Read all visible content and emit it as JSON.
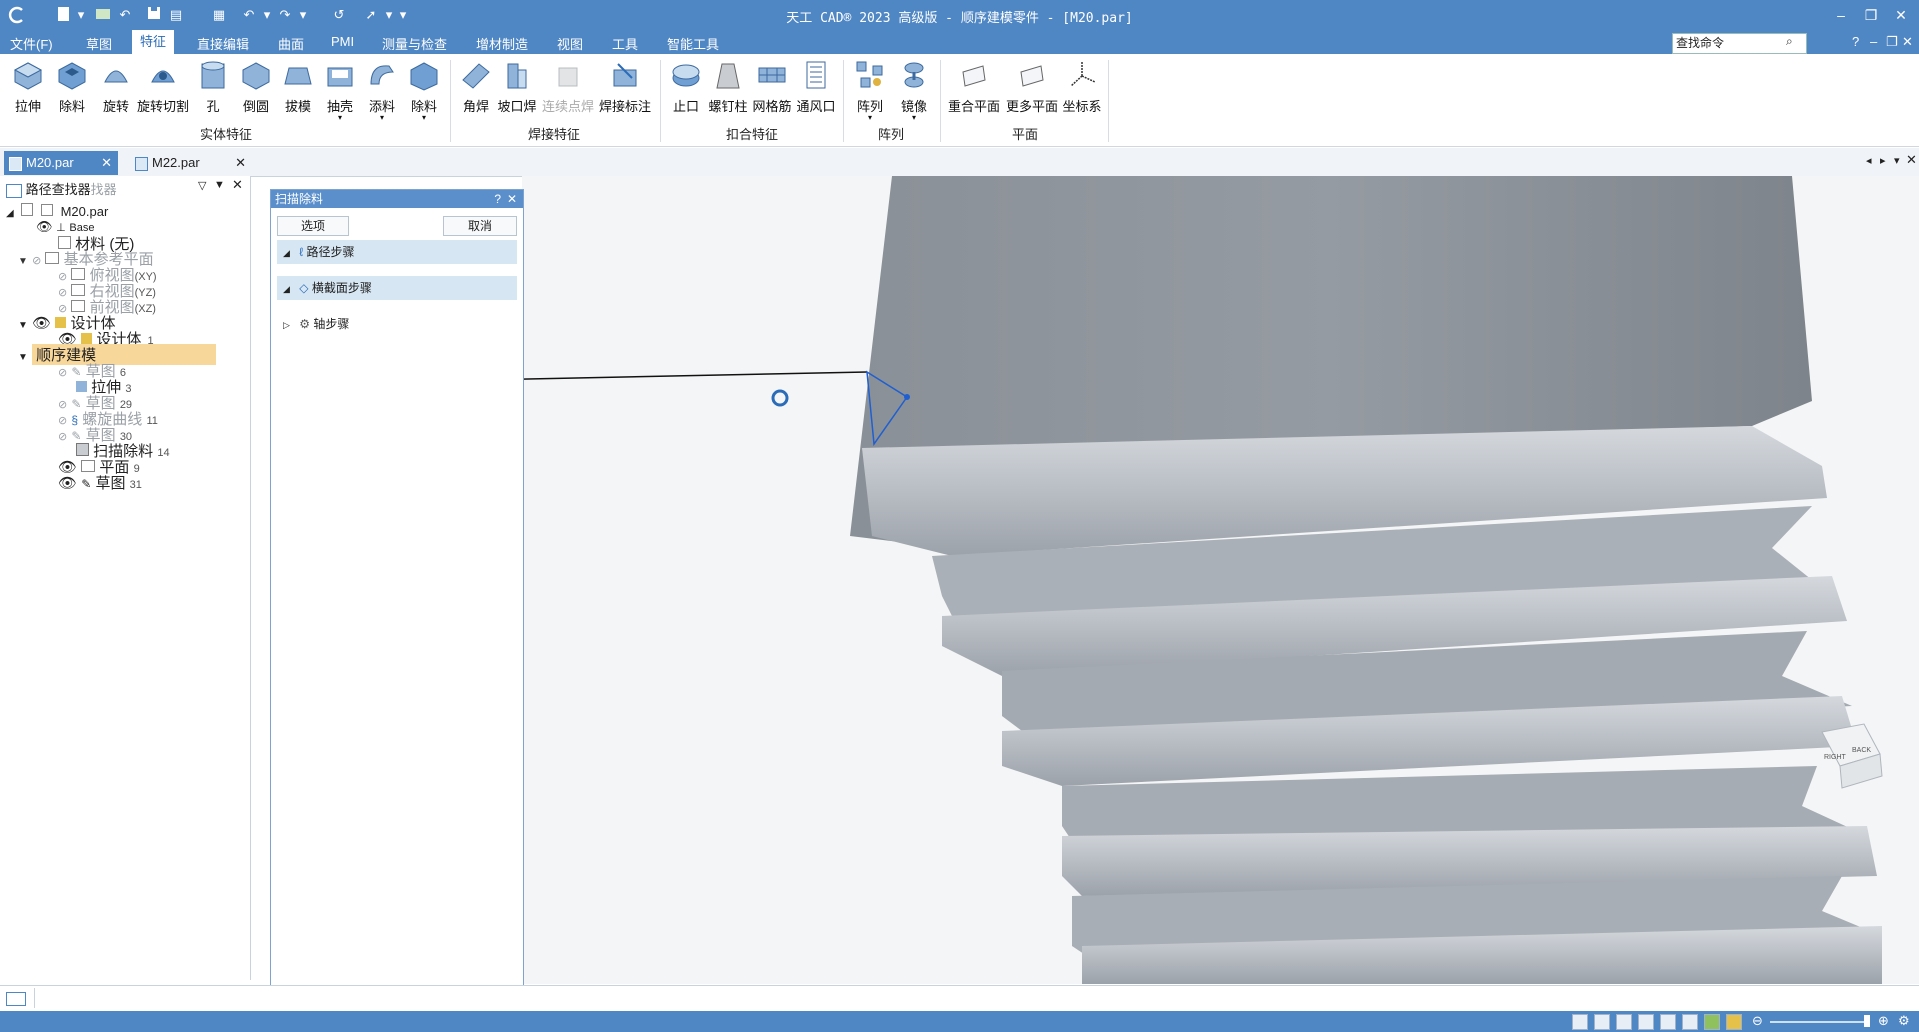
{
  "app": {
    "title": "天工 CAD® 2023 高级版 - 顺序建模零件 - [M20.par]",
    "accent": "#4f86c4"
  },
  "menu": {
    "items": [
      "文件(F)",
      "草图",
      "特征",
      "直接编辑",
      "曲面",
      "PMI",
      "测量与检查",
      "增材制造",
      "视图",
      "工具",
      "智能工具"
    ],
    "active": "特征",
    "search_placeholder": "查找命令",
    "help": "?"
  },
  "ribbon": {
    "solid": {
      "group_label": "实体特征",
      "tools": [
        "拉伸",
        "除料",
        "旋转",
        "旋转切割",
        "孔",
        "倒圆",
        "拔模",
        "抽壳",
        "添料",
        "除料"
      ]
    },
    "weld": {
      "group_label": "焊接特征",
      "tools": [
        "角焊",
        "坡口焊",
        "连续点焊",
        "焊接标注"
      ]
    },
    "buckle": {
      "group_label": "扣合特征",
      "tools": [
        "止口",
        "螺钉柱",
        "网格筋",
        "通风口"
      ]
    },
    "pattern": {
      "group_label": "阵列",
      "tools": [
        "阵列",
        "镜像"
      ]
    },
    "plane": {
      "group_label": "平面",
      "tools": [
        "重合平面",
        "更多平面",
        "坐标系"
      ]
    }
  },
  "tabs": [
    {
      "label": "M20.par",
      "active": true
    },
    {
      "label": "M22.par",
      "active": false
    }
  ],
  "pathfinder": {
    "title": "路径查找器",
    "title_faded": "找器",
    "root": "M20.par",
    "base": "Base",
    "material": "材料 (无)",
    "ref_planes": "基本参考平面",
    "planes": [
      {
        "name": "俯视图",
        "axis": "(XY)"
      },
      {
        "name": "右视图",
        "axis": "(YZ)"
      },
      {
        "name": "前视图",
        "axis": "(XZ)"
      }
    ],
    "design_body": "设计体",
    "design_body_item": {
      "name": "设计体",
      "num": "_1"
    },
    "ordered": "顺序建模",
    "features": [
      {
        "name": "草图",
        "num": "6",
        "dim": true
      },
      {
        "name": "拉伸",
        "num": "3",
        "dim": false
      },
      {
        "name": "草图",
        "num": "29",
        "dim": true
      },
      {
        "name": "螺旋曲线",
        "num": "11",
        "dim": true
      },
      {
        "name": "草图",
        "num": "30",
        "dim": true
      },
      {
        "name": "扫描除料",
        "num": "14",
        "dim": false
      },
      {
        "name": "平面",
        "num": "9",
        "dim": false
      },
      {
        "name": "草图",
        "num": "31",
        "dim": false
      }
    ]
  },
  "sweep_panel": {
    "title": "扫描除料",
    "help": "?",
    "options_label": "选项",
    "cancel_label": "取消",
    "steps": [
      "路径步骤",
      "横截面步骤",
      "轴步骤"
    ]
  },
  "viewcube": {
    "labels": [
      "RIGHT",
      "BACK"
    ]
  }
}
